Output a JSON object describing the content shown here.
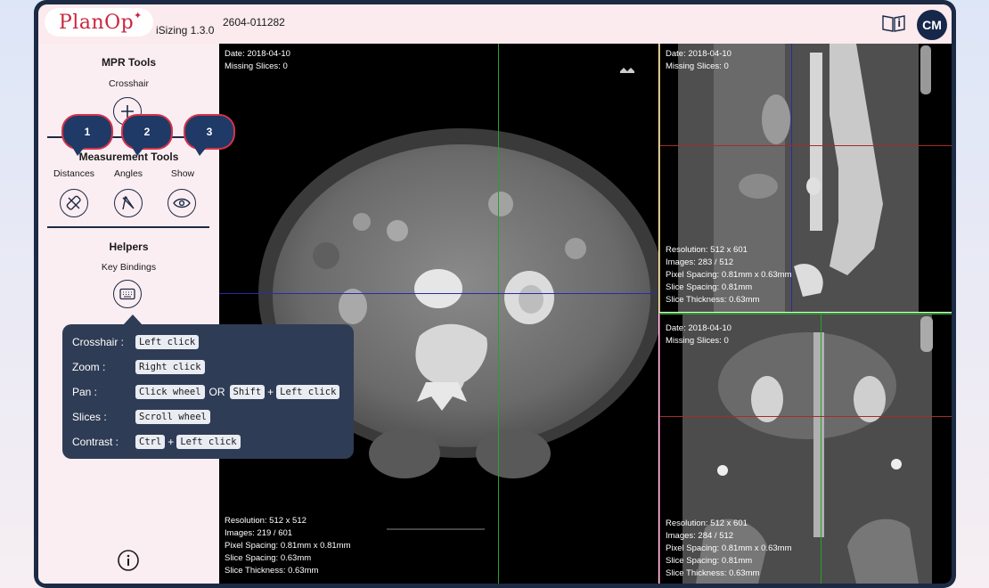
{
  "header": {
    "logo": "PlanOp",
    "version": "iSizing 1.3.0",
    "case_id": "2604-011282",
    "avatar_initials": "CM"
  },
  "sidebar": {
    "mpr_title": "MPR Tools",
    "crosshair_label": "Crosshair",
    "measurement_title": "Measurement Tools",
    "distances_label": "Distances",
    "angles_label": "Angles",
    "show_label": "Show",
    "helpers_title": "Helpers",
    "keybindings_label": "Key Bindings",
    "badges": [
      "1",
      "2",
      "3"
    ]
  },
  "keybindings": {
    "crosshair": {
      "label": "Crosshair :",
      "key1": "Left click"
    },
    "zoom": {
      "label": "Zoom :",
      "key1": "Right click"
    },
    "pan": {
      "label": "Pan :",
      "key1": "Click wheel",
      "or": "OR",
      "key2": "Shift",
      "plus": "+",
      "key3": "Left click"
    },
    "slices": {
      "label": "Slices :",
      "key1": "Scroll wheel"
    },
    "contrast": {
      "label": "Contrast :",
      "key1": "Ctrl",
      "plus": "+",
      "key2": "Left click"
    }
  },
  "viewers": {
    "axial": {
      "date": "Date: 2018-04-10",
      "missing": "Missing Slices: 0",
      "resolution": "Resolution: 512 x 512",
      "images": "Images: 219 / 601",
      "pixel_spacing": "Pixel Spacing: 0.81mm x 0.81mm",
      "slice_spacing": "Slice Spacing: 0.63mm",
      "slice_thickness": "Slice Thickness: 0.63mm"
    },
    "sagittal": {
      "date": "Date: 2018-04-10",
      "missing": "Missing Slices: 0",
      "resolution": "Resolution: 512 x 601",
      "images": "Images: 283 / 512",
      "pixel_spacing": "Pixel Spacing: 0.81mm x 0.63mm",
      "slice_spacing": "Slice Spacing: 0.81mm",
      "slice_thickness": "Slice Thickness: 0.63mm"
    },
    "coronal": {
      "date": "Date: 2018-04-10",
      "missing": "Missing Slices: 0",
      "resolution": "Resolution: 512 x 601",
      "images": "Images: 284 / 512",
      "pixel_spacing": "Pixel Spacing: 0.81mm x 0.63mm",
      "slice_spacing": "Slice Spacing: 0.81mm",
      "slice_thickness": "Slice Thickness: 0.63mm"
    }
  },
  "colors": {
    "brand": "#c8273f",
    "navy": "#1c2a44",
    "crosshair_green": "#2aa02a",
    "crosshair_blue": "#2a2aa8",
    "crosshair_red": "#a82a2a"
  },
  "icons": {
    "manual": "book-info-icon",
    "crosshair": "plus-icon",
    "distances": "ruler-icon",
    "angles": "angle-icon",
    "show": "eye-icon",
    "keybindings": "keyboard-icon",
    "info": "info-icon"
  }
}
